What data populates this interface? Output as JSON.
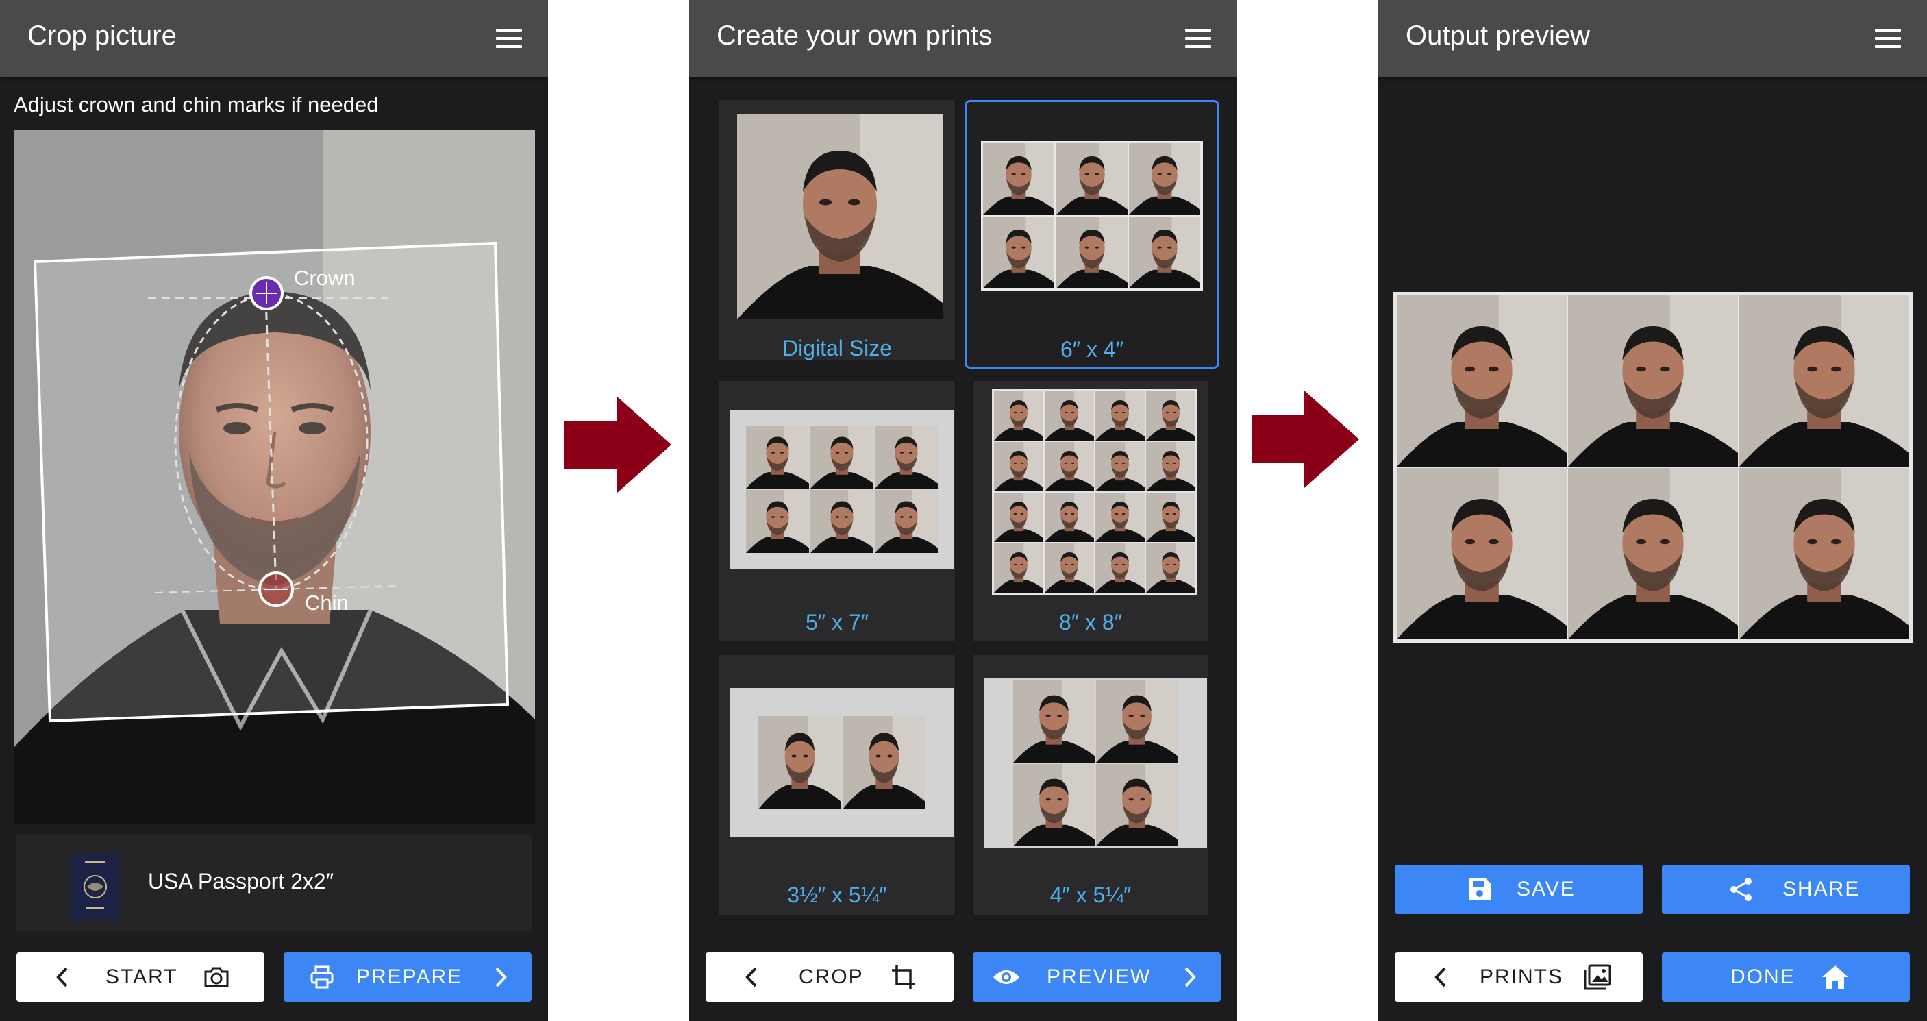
{
  "screens": [
    {
      "title": "Crop picture",
      "instruction": "Adjust crown and chin marks if needed",
      "marks": {
        "crown": "Crown",
        "chin": "Chin"
      },
      "document": {
        "label": "USA Passport 2x2″",
        "icon": "passport-icon"
      },
      "buttons": {
        "back": "START",
        "next": "PREPARE"
      }
    },
    {
      "title": "Create your own prints",
      "tiles": [
        {
          "label": "Digital Size",
          "selected": false
        },
        {
          "label": "6″ x 4″",
          "selected": true
        },
        {
          "label": "5″ x 7″",
          "selected": false
        },
        {
          "label": "8″ x 8″",
          "selected": false
        },
        {
          "label": "3½″ x 5¼″",
          "selected": false
        },
        {
          "label": "4″ x 5¼″",
          "selected": false
        }
      ],
      "buttons": {
        "back": "CROP",
        "next": "PREVIEW"
      }
    },
    {
      "title": "Output preview",
      "actions": {
        "save": "SAVE",
        "share": "SHARE"
      },
      "buttons": {
        "back": "PRINTS",
        "next": "DONE"
      }
    }
  ],
  "colors": {
    "accent": "#3d86f5",
    "arrow": "#8b0016",
    "appbar": "#4a4a4a",
    "background": "#1c1c1e",
    "link": "#4fb0ea"
  }
}
